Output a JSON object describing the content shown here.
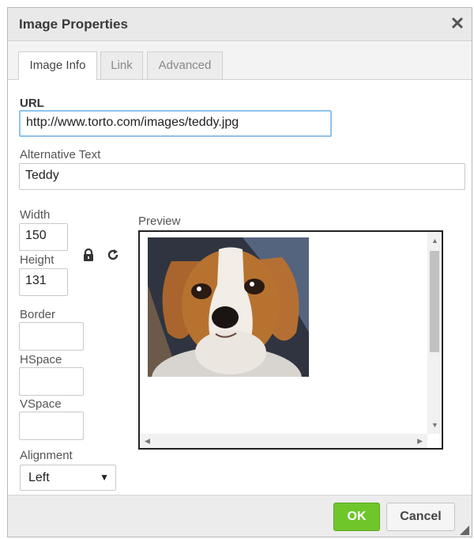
{
  "dialog": {
    "title": "Image Properties",
    "close_icon": "close-icon"
  },
  "tabs": [
    {
      "label": "Image Info",
      "active": true
    },
    {
      "label": "Link",
      "active": false
    },
    {
      "label": "Advanced",
      "active": false
    }
  ],
  "fields": {
    "url_label": "URL",
    "url_value": "http://www.torto.com/images/teddy.jpg",
    "alt_label": "Alternative Text",
    "alt_value": "Teddy",
    "width_label": "Width",
    "width_value": "150",
    "height_label": "Height",
    "height_value": "131",
    "border_label": "Border",
    "border_value": "",
    "hspace_label": "HSpace",
    "hspace_value": "",
    "vspace_label": "VSpace",
    "vspace_value": "",
    "alignment_label": "Alignment",
    "alignment_value": "Left"
  },
  "icons": {
    "lock": "lock-icon",
    "reset": "reset-size-icon"
  },
  "preview": {
    "label": "Preview",
    "image": "dog-photo"
  },
  "footer": {
    "ok_label": "OK",
    "cancel_label": "Cancel"
  },
  "colors": {
    "ok_button": "#6fc62b",
    "focus_border": "#8ec3ee"
  }
}
